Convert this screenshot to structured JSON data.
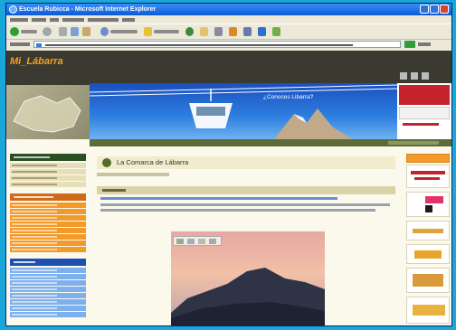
{
  "window": {
    "title": "Escuela Rubicca - Microsoft Internet Explorer"
  },
  "site": {
    "logo": "Mi_Lábarra",
    "banner_question": "¿Conoces Libarra?",
    "page_title": "La Comarca de Lábarra"
  },
  "colors": {
    "desktop": "#1aa6d8",
    "titlebar": "#0a5ad8",
    "header_dark": "#3a3a30",
    "nav_head": "#2b4f24",
    "accent_orange": "#f39a2b",
    "accent_green": "#5d6a3a",
    "link_blue": "#2f5fd0"
  },
  "icons": [
    "internet-explorer-icon",
    "back-icon",
    "forward-icon",
    "stop-icon",
    "refresh-icon",
    "home-icon",
    "search-icon",
    "favorites-icon",
    "history-icon",
    "mail-icon",
    "print-icon",
    "go-icon",
    "cable-car-icon",
    "photo-toolbar-icon"
  ]
}
